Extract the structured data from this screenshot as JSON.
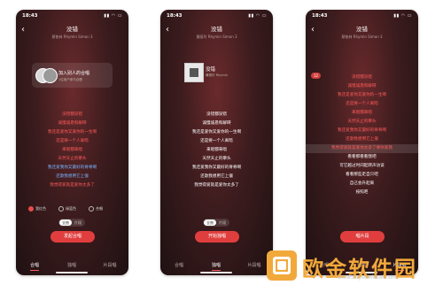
{
  "status": {
    "time": "18:43"
  },
  "song": {
    "title": "没错",
    "subtitle": "蔡依林 Rhymin Simon 3",
    "sub2": "黄丽玲 Rhymin Simon 3"
  },
  "colors": {
    "primary": "#e03e3e",
    "lyric_red": "#ff5a5a",
    "lyric_blue": "#7ab4ff"
  },
  "phone1": {
    "header_title": "加入别人的合唱",
    "header_sub": "1位用户参与合唱",
    "lyrics": [
      {
        "text": "没错都没错",
        "c": "red"
      },
      {
        "text": "诚慢诚恳和解碍",
        "c": "red"
      },
      {
        "text": "我还是爱你又爱你的一生啊",
        "c": "red"
      },
      {
        "text": "还是要一个人离暗",
        "c": "red"
      },
      {
        "text": "来唱都来唱",
        "c": "red"
      },
      {
        "text": "天然天止的攀头",
        "c": "red"
      },
      {
        "text": "我还爱我你又最好的脊脊啊",
        "c": "blue"
      },
      {
        "text": "还歌我想用它上僵",
        "c": "blue"
      },
      {
        "text": "我觉得爱就是爱你太多了",
        "c": "red"
      }
    ],
    "radios": [
      {
        "label": "我红色",
        "on": true
      },
      {
        "label": "绿蓝色",
        "on": false
      },
      {
        "label": "合唱",
        "on": false
      }
    ],
    "toggle": {
      "on": "全曲",
      "off": "片段"
    },
    "button": "发起合唱",
    "tabs": [
      "合唱",
      "独唱",
      "片段唱"
    ]
  },
  "phone2": {
    "song_title": "没错",
    "song_sub": "黄丽玲 Rhymin",
    "lyrics": [
      "没错都没错",
      "诚慢诚恳和解碍",
      "我还是爱你又爱你的一生啊",
      "还是要一个人离暗",
      "来唱都来唱",
      "天然天止的攀头",
      "我还爱我你又最好的脊脊啊",
      "还歌我想用它上僵",
      "我觉得爱就是爱你太多了"
    ],
    "toggle": {
      "on": "全曲",
      "off": "片段"
    },
    "button": "开始独唱",
    "tabs": [
      "合唱",
      "独唱",
      "片段唱"
    ]
  },
  "phone3": {
    "badge": "12",
    "lyrics": [
      {
        "text": "没错都没错",
        "c": "red"
      },
      {
        "text": "诚慢诚恳和解碍",
        "c": "red"
      },
      {
        "text": "我还是爱你又爱你的一生啊",
        "c": "red"
      },
      {
        "text": "还是要一个人离暗",
        "c": "red"
      },
      {
        "text": "来唱都来唱",
        "c": "red"
      },
      {
        "text": "天然天止的攀头",
        "c": "red"
      },
      {
        "text": "我还爱我你又最好的脊脊啊",
        "c": "red"
      },
      {
        "text": "还歌我想用它上僵",
        "c": "red"
      },
      {
        "text": "我觉得爱就是爱你太多了要你爱我",
        "c": "red",
        "hl": true
      },
      {
        "text": "看看那看看我吧",
        "c": "white"
      },
      {
        "text": "可它越过时间起转声访谈",
        "c": "white"
      },
      {
        "text": "看看那些走自只吧",
        "c": "white"
      },
      {
        "text": "自己会升起来",
        "c": "white"
      },
      {
        "text": "按照吧",
        "c": "white"
      }
    ],
    "button": "唱片段",
    "tabs": [
      "合唱",
      "独唱",
      "片段唱"
    ]
  },
  "logo": {
    "text": "欧金软件园",
    "url": "www.ouyaoxiazai.com"
  }
}
